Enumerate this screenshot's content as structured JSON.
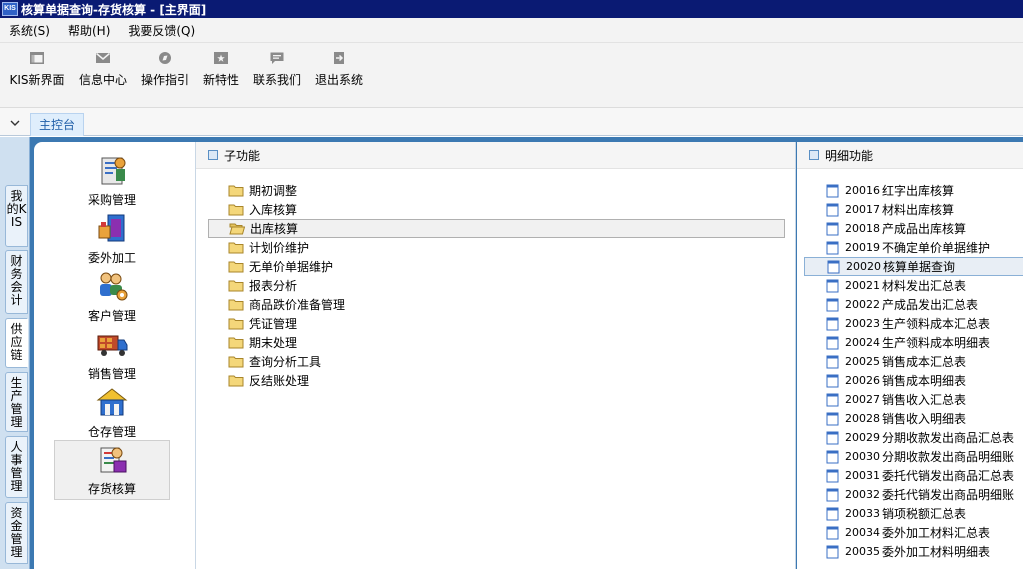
{
  "window": {
    "title": "核算单据查询-存货核算 - [主界面]",
    "logo_text": "KIS"
  },
  "menu": [
    {
      "label": "系统(S)"
    },
    {
      "label": "帮助(H)"
    },
    {
      "label": "我要反馈(Q)"
    }
  ],
  "toolbar": [
    {
      "label": "KIS新界面",
      "icon": "new-ui-icon"
    },
    {
      "label": "信息中心",
      "icon": "mail-icon"
    },
    {
      "label": "操作指引",
      "icon": "compass-icon"
    },
    {
      "label": "新特性",
      "icon": "star-icon"
    },
    {
      "label": "联系我们",
      "icon": "chat-icon"
    },
    {
      "label": "退出系统",
      "icon": "exit-icon"
    }
  ],
  "tabs": [
    {
      "label": "主控台"
    }
  ],
  "side_tabs": [
    {
      "label": "我的KIS"
    },
    {
      "label": "财务会计"
    },
    {
      "label": "供应链",
      "active": true
    },
    {
      "label": "生产管理"
    },
    {
      "label": "人事管理"
    },
    {
      "label": "资金管理"
    }
  ],
  "modules": [
    {
      "label": "采购管理",
      "icon": "purchase-icon"
    },
    {
      "label": "委外加工",
      "icon": "outsource-icon"
    },
    {
      "label": "客户管理",
      "icon": "customer-icon"
    },
    {
      "label": "销售管理",
      "icon": "sales-truck-icon"
    },
    {
      "label": "仓存管理",
      "icon": "warehouse-icon"
    },
    {
      "label": "存货核算",
      "icon": "inventory-accounting-icon",
      "active": true
    }
  ],
  "sub_panel": {
    "title": "子功能",
    "items": [
      {
        "label": "期初调整"
      },
      {
        "label": "入库核算"
      },
      {
        "label": "出库核算",
        "active": true
      },
      {
        "label": "计划价维护"
      },
      {
        "label": "无单价单据维护"
      },
      {
        "label": "报表分析"
      },
      {
        "label": "商品跌价准备管理"
      },
      {
        "label": "凭证管理"
      },
      {
        "label": "期末处理"
      },
      {
        "label": "查询分析工具"
      },
      {
        "label": "反结账处理"
      }
    ]
  },
  "detail_panel": {
    "title": "明细功能",
    "items": [
      {
        "code": "20016",
        "label": "红字出库核算"
      },
      {
        "code": "20017",
        "label": "材料出库核算"
      },
      {
        "code": "20018",
        "label": "产成品出库核算"
      },
      {
        "code": "20019",
        "label": "不确定单价单据维护"
      },
      {
        "code": "20020",
        "label": "核算单据查询",
        "active": true
      },
      {
        "code": "20021",
        "label": "材料发出汇总表"
      },
      {
        "code": "20022",
        "label": "产成品发出汇总表"
      },
      {
        "code": "20023",
        "label": "生产领料成本汇总表"
      },
      {
        "code": "20024",
        "label": "生产领料成本明细表"
      },
      {
        "code": "20025",
        "label": "销售成本汇总表"
      },
      {
        "code": "20026",
        "label": "销售成本明细表"
      },
      {
        "code": "20027",
        "label": "销售收入汇总表"
      },
      {
        "code": "20028",
        "label": "销售收入明细表"
      },
      {
        "code": "20029",
        "label": "分期收款发出商品汇总表"
      },
      {
        "code": "20030",
        "label": "分期收款发出商品明细账"
      },
      {
        "code": "20031",
        "label": "委托代销发出商品汇总表"
      },
      {
        "code": "20032",
        "label": "委托代销发出商品明细账"
      },
      {
        "code": "20033",
        "label": "销项税额汇总表"
      },
      {
        "code": "20034",
        "label": "委外加工材料汇总表"
      },
      {
        "code": "20035",
        "label": "委外加工材料明细表"
      }
    ]
  }
}
